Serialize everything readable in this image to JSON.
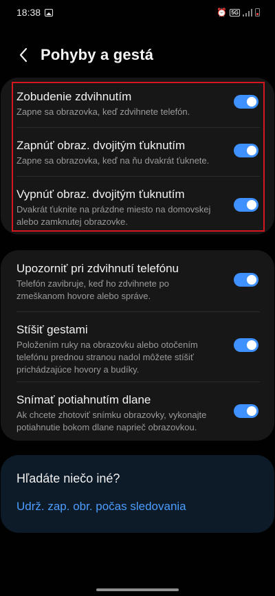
{
  "status_bar": {
    "time": "18:38",
    "network_label": "5G",
    "icons": [
      "gallery-icon",
      "alarm-icon",
      "5g-icon",
      "signal-icon",
      "battery-icon"
    ]
  },
  "header": {
    "title": "Pohyby a gestá",
    "back_icon": "chevron-left-icon"
  },
  "section1": {
    "items": [
      {
        "title": "Zobudenie zdvihnutím",
        "description": "Zapne sa obrazovka, keď zdvihnete telefón.",
        "enabled": true
      },
      {
        "title": "Zapnúť obraz. dvojitým ťuknutím",
        "description": "Zapne sa obrazovka, keď na ňu dvakrát ťuknete.",
        "enabled": true
      },
      {
        "title": "Vypnúť obraz. dvojitým ťuknutím",
        "description": "Dvakrát ťuknite na prázdne miesto na domovskej alebo zamknutej obrazovke.",
        "enabled": true
      }
    ]
  },
  "section2": {
    "items": [
      {
        "title": "Upozorniť pri zdvihnutí telefónu",
        "description": "Telefón zavibruje, keď ho zdvihnete po zmeškanom hovore alebo správe.",
        "enabled": true
      },
      {
        "title": "Stíšiť gestami",
        "description": "Položením ruky na obrazovku alebo otočením telefónu prednou stranou nadol môžete stíšiť prichádzajúce hovory a budíky.",
        "enabled": true
      },
      {
        "title": "Snímať potiahnutím dlane",
        "description": "Ak chcete zhotoviť snímku obrazovky, vykonajte potiahnutie bokom dlane naprieč obrazovkou.",
        "enabled": true
      }
    ]
  },
  "suggestions": {
    "title": "Hľadáte niečo iné?",
    "link": "Udrž. zap. obr. počas sledovania"
  },
  "colors": {
    "background": "#010101",
    "card": "#171717",
    "toggle_on": "#3e91ff",
    "link": "#4b9dff",
    "highlight": "#d8161e"
  }
}
